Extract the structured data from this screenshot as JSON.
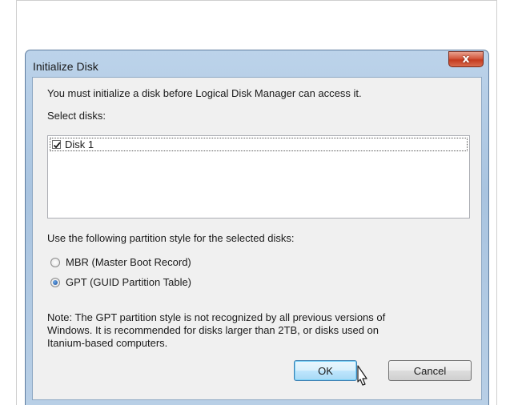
{
  "dialog": {
    "title": "Initialize Disk",
    "close_glyph": "x",
    "intro": "You must initialize a disk before Logical Disk Manager can access it.",
    "select_label": "Select disks:",
    "disks": [
      {
        "label": "Disk 1",
        "checked": true
      }
    ],
    "partition_prompt": "Use the following partition style for the selected disks:",
    "options": [
      {
        "label": "MBR (Master Boot Record)",
        "selected": false
      },
      {
        "label": "GPT (GUID Partition Table)",
        "selected": true
      }
    ],
    "note_lines": [
      "Note: The GPT partition style is not recognized by all previous versions of",
      "Windows. It is recommended for disks larger than 2TB, or disks used on",
      "Itanium-based computers."
    ],
    "ok_label": "OK",
    "cancel_label": "Cancel"
  },
  "icons": {
    "close": "close-icon",
    "check": "checkmark-icon",
    "cursor": "mouse-pointer-icon"
  }
}
